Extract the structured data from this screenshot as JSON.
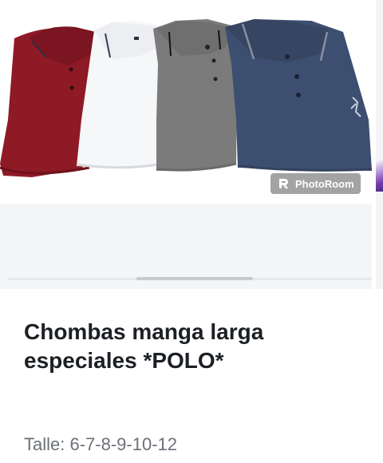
{
  "product": {
    "title": "Chombas manga larga especiales *POLO*",
    "sizes": "Talle: 6-7-8-9-10-12"
  },
  "gallery": {
    "watermark_label": "PhotoRoom",
    "watermark_icon": "photoroom-logo-icon",
    "shirt_colors": [
      "#8e1a26",
      "#f4f5f7",
      "#7b7b7b",
      "#3d4f70"
    ],
    "scroll_position": 0.36
  }
}
